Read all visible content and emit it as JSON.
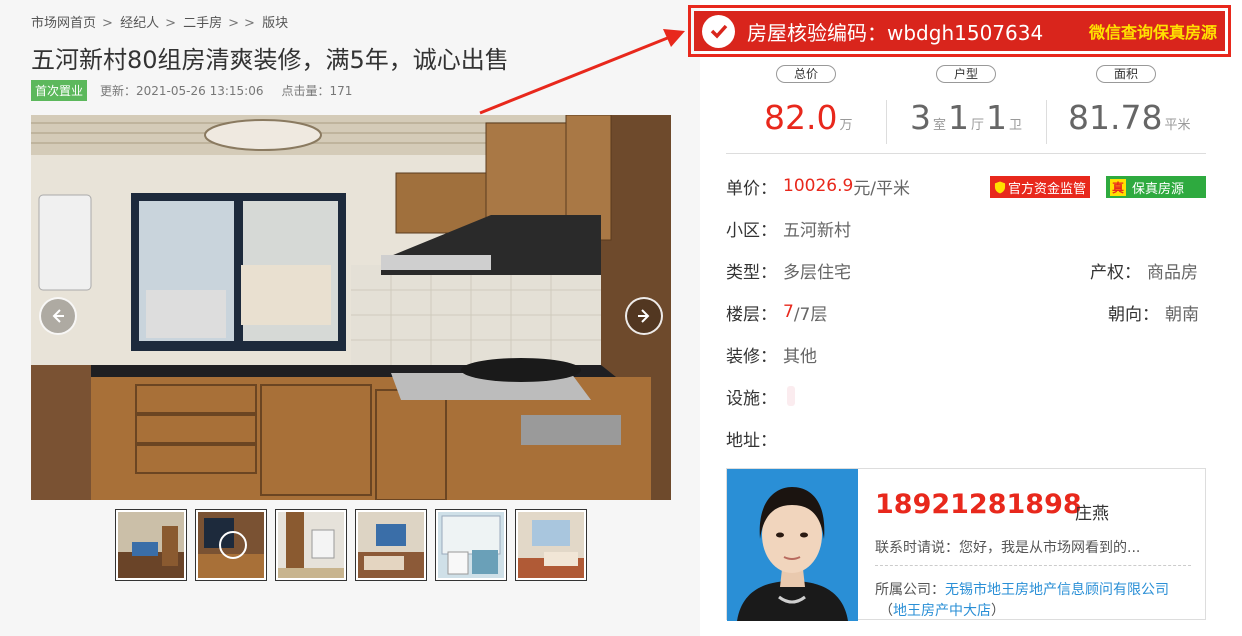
{
  "breadcrumb": {
    "items": [
      "市场网首页",
      "经纪人",
      "二手房",
      "",
      "版块"
    ],
    "separator": ">"
  },
  "listing": {
    "title": "五河新村80组房清爽装修，满5年，诚心出售",
    "tag": "首次置业",
    "updated": "更新：2021-05-26 13:15:06",
    "views": "点击量：171"
  },
  "verify": {
    "label": "房屋核验编码：wbdgh1507634",
    "link": "微信查询保真房源"
  },
  "specs": {
    "price_label": "总价",
    "price_value": "82.0",
    "price_unit": "万",
    "layout_label": "户型",
    "rooms": "3",
    "rooms_unit": "室",
    "halls": "1",
    "halls_unit": "厅",
    "baths": "1",
    "baths_unit": "卫",
    "area_label": "面积",
    "area_value": "81.78",
    "area_unit": "平米"
  },
  "details": {
    "unit_price_key": "单价：",
    "unit_price_num": "10026.9",
    "unit_price_unit": "元/平米",
    "badge_fund": "官方资金监管",
    "badge_real_mark": "真",
    "badge_real": "保真房源",
    "community_key": "小区：",
    "community_val": "五河新村",
    "type_key": "类型：",
    "type_val": "多层住宅",
    "rights_key": "产权：",
    "rights_val": "商品房",
    "floor_key": "楼层：",
    "floor_current": "7",
    "floor_total": "/7层",
    "orient_key": "朝向：",
    "orient_val": "朝南",
    "deco_key": "装修：",
    "deco_val": "其他",
    "facility_key": "设施：",
    "address_key": "地址："
  },
  "agent": {
    "phone": "18921281898",
    "name": "庄燕",
    "say": "联系时请说：您好，我是从市场网看到的...",
    "company_label": "所属公司：",
    "company": "无锡市地王房地产信息顾问有限公司",
    "branch_open": "（",
    "branch": "地王房产中大店",
    "branch_close": "）"
  },
  "colors": {
    "accent_red": "#e8281c",
    "verify_bg": "#d9251c",
    "verify_link": "#ffe100",
    "green": "#2eaa3f",
    "link_blue": "#2a8fd6"
  },
  "icons": [
    "check-icon",
    "chevron-left-icon",
    "chevron-right-icon",
    "shield-icon",
    "red-pointer-arrow"
  ]
}
